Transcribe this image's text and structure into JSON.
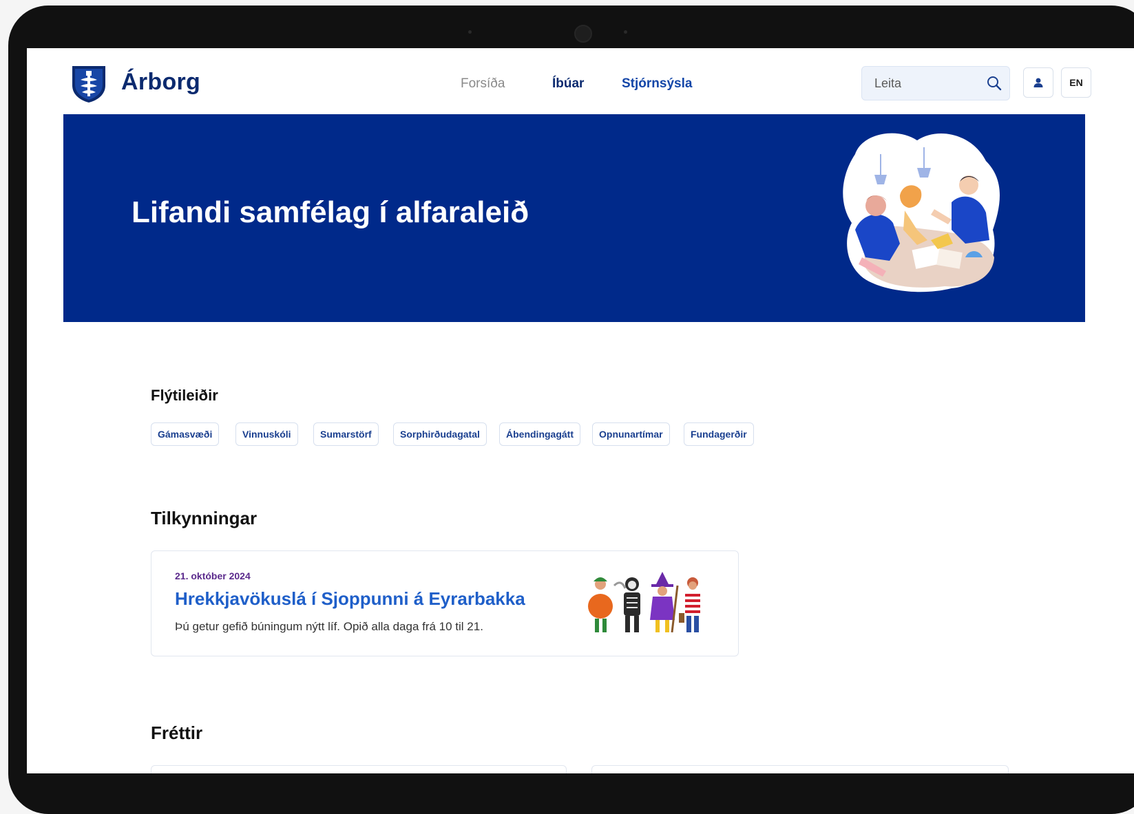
{
  "header": {
    "brand": "Árborg",
    "nav": [
      "Forsíða",
      "Íbúar",
      "Stjórnsýsla"
    ],
    "search_placeholder": "Leita",
    "lang_label": "EN"
  },
  "hero": {
    "title": "Lifandi samfélag í alfaraleið"
  },
  "shortcuts": {
    "title": "Flýtileiðir",
    "items": [
      "Gámasvæði",
      "Vinnuskóli",
      "Sumarstörf",
      "Sorphirðudagatal",
      "Ábendingagátt",
      "Opnunartímar",
      "Fundagerðir"
    ]
  },
  "notices": {
    "title": "Tilkynningar",
    "items": [
      {
        "date": "21. október 2024",
        "title": "Hrekkjavökuslá í Sjoppunni á Eyrarbakka",
        "body": "Þú getur gefið búningum nýtt líf. Opið alla daga frá 10 til 21."
      }
    ]
  },
  "news": {
    "title": "Fréttir"
  },
  "icons": {
    "logo": "arborg-crest-icon",
    "search": "search-icon",
    "user": "user-icon"
  },
  "colors": {
    "brand_navy": "#0b2a6f",
    "hero_blue": "#00298a",
    "link_blue": "#1f5fc9",
    "date_purple": "#5b2a8c"
  }
}
